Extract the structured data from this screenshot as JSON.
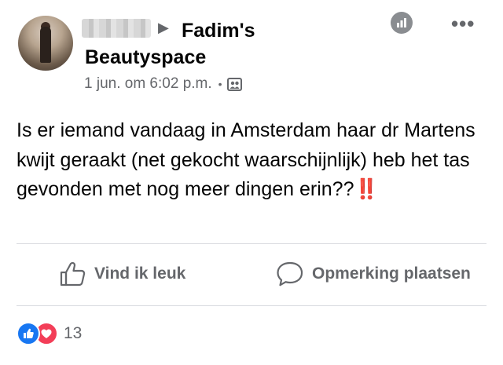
{
  "post": {
    "group_name": "Fadim's Beautyspace",
    "timestamp": "1 jun. om 6:02 p.m.",
    "separator": "•",
    "body": "Is er iemand vandaag in Amsterdam haar dr Martens kwijt geraakt (net gekocht waarschijnlijk) heb het tas gevonden met nog meer dingen erin??",
    "emoji": "‼️"
  },
  "actions": {
    "like_label": "Vind ik leuk",
    "comment_label": "Opmerking plaatsen"
  },
  "reactions": {
    "count": "13",
    "types": [
      "like-icon",
      "love-icon"
    ]
  },
  "colors": {
    "secondary_text": "#65676b",
    "like_blue": "#1877f2",
    "love_red": "#f33e58"
  }
}
